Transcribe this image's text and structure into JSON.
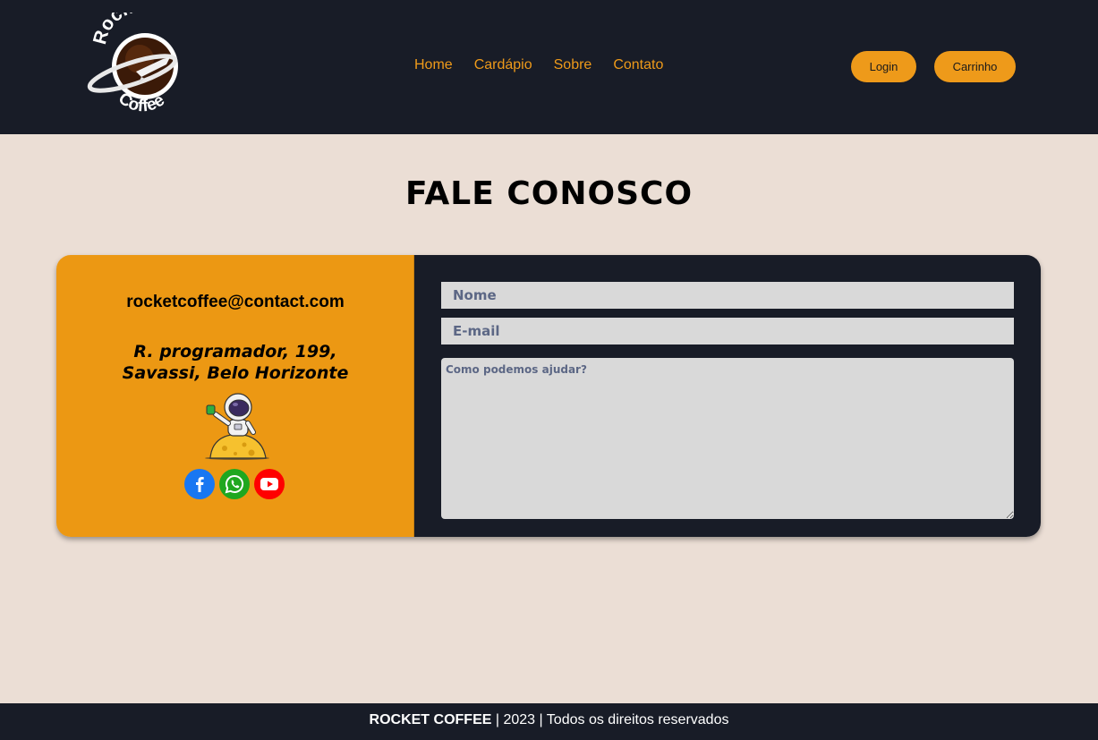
{
  "logo": {
    "top_text": "Rocket",
    "bottom_text": "Coffee"
  },
  "nav": {
    "items": [
      {
        "label": "Home"
      },
      {
        "label": "Cardápio"
      },
      {
        "label": "Sobre"
      },
      {
        "label": "Contato"
      }
    ]
  },
  "header_buttons": {
    "login_label": "Login",
    "cart_label": "Carrinho"
  },
  "page": {
    "title": "FALE CONOSCO"
  },
  "contact": {
    "email": "rocketcoffee@contact.com",
    "address_line1": "R. programador, 199,",
    "address_line2": "Savassi, Belo Horizonte",
    "socials": [
      {
        "icon": "facebook-icon",
        "color": "#1877f2"
      },
      {
        "icon": "whatsapp-icon",
        "color": "#1fa71f"
      },
      {
        "icon": "youtube-icon",
        "color": "#ff0000"
      }
    ]
  },
  "form": {
    "name_placeholder": "Nome",
    "email_placeholder": "E-mail",
    "message_placeholder": "Como podemos ajudar?",
    "name_value": "",
    "email_value": "",
    "message_value": ""
  },
  "footer": {
    "brand": "ROCKET COFFEE",
    "rest": " | 2023 | Todos os direitos reservados"
  },
  "colors": {
    "header_bg": "#181c27",
    "accent": "#ee9a1a",
    "page_bg": "#ebded5",
    "input_bg": "#d9d9d9",
    "placeholder_text": "#5c6785"
  }
}
